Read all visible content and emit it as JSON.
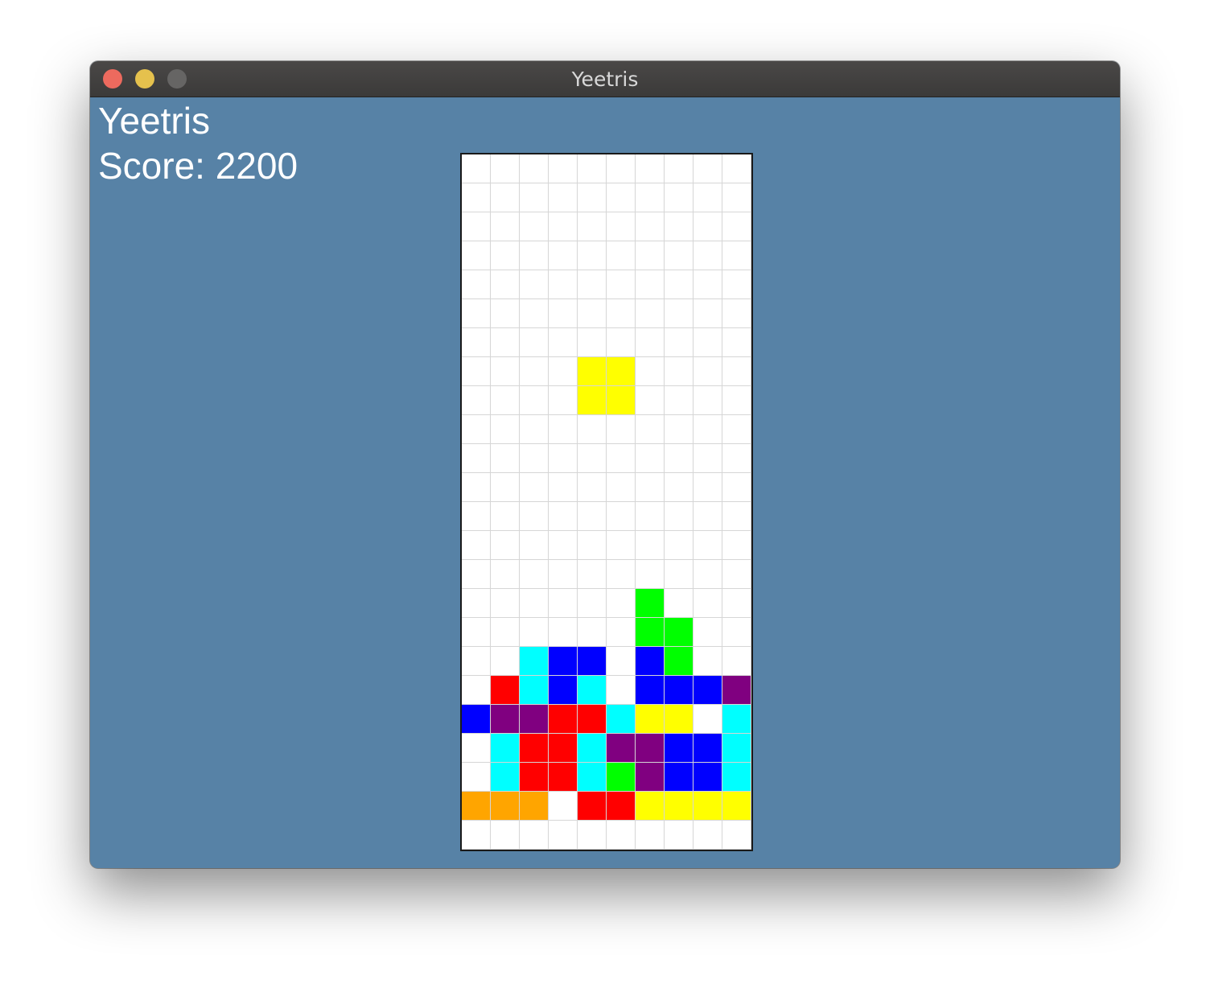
{
  "window": {
    "title": "Yeetris"
  },
  "game": {
    "title": "Yeetris",
    "score_text": "Score: 2200",
    "score": 2200
  },
  "board": {
    "columns": 10,
    "rows": 24,
    "colors": {
      ".": "#ffffff",
      "Y": "#ffff00",
      "G": "#00ff00",
      "C": "#00ffff",
      "B": "#0000ff",
      "R": "#ff0000",
      "P": "#800080",
      "O": "#ffa500"
    },
    "color_names": {
      "Y": "yellow",
      "G": "green",
      "C": "cyan",
      "B": "blue",
      "R": "red",
      "P": "purple",
      "O": "orange"
    },
    "grid": [
      "..........",
      "..........",
      "..........",
      "..........",
      "..........",
      "..........",
      "..........",
      "....YY....",
      "....YY....",
      "..........",
      "..........",
      "..........",
      "..........",
      "..........",
      "..........",
      "......G...",
      "......GG..",
      "..CBB.BG..",
      ".RCBC.BBBP",
      "BPPRRCYY.C",
      ".CRRCPPBBC",
      ".CRRCGPBBC",
      "OOO.RRYYYY",
      ".........."
    ]
  }
}
